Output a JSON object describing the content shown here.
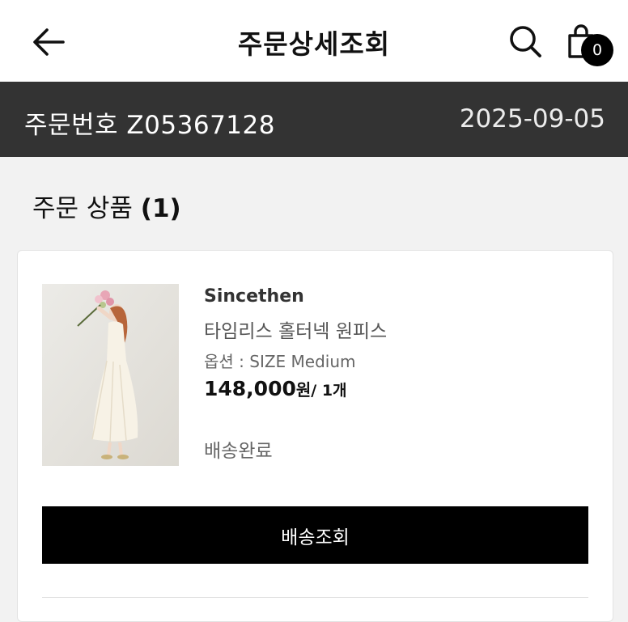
{
  "header": {
    "title": "주문상세조회",
    "cart_count": "0"
  },
  "order": {
    "label": "주문번호 Z05367128",
    "date": "2025-09-05"
  },
  "section": {
    "title": "주문 상품 ",
    "count": "(1)"
  },
  "product": {
    "brand": "Sincethen",
    "name": "타임리스 홀터넥 원피스",
    "option": "옵션 : SIZE Medium",
    "price": "148,000",
    "currency": "원",
    "quantity": "/ 1개",
    "status": "배송완료"
  },
  "actions": {
    "track_label": "배송조회"
  },
  "colors": {
    "order_bar": "#333333",
    "button": "#000000",
    "background": "#f2f2f2"
  },
  "icons": [
    "back-arrow-icon",
    "search-icon",
    "shopping-bag-icon"
  ]
}
